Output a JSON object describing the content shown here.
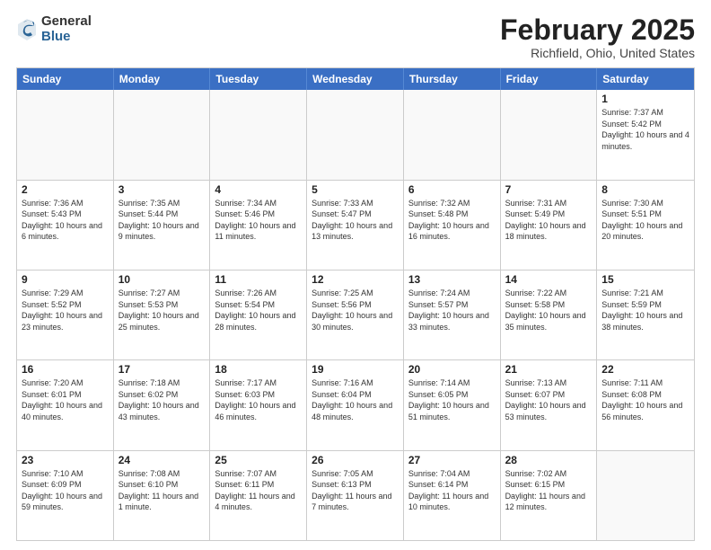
{
  "header": {
    "logo_general": "General",
    "logo_blue": "Blue",
    "title": "February 2025",
    "subtitle": "Richfield, Ohio, United States"
  },
  "days_of_week": [
    "Sunday",
    "Monday",
    "Tuesday",
    "Wednesday",
    "Thursday",
    "Friday",
    "Saturday"
  ],
  "weeks": [
    [
      {
        "day": "",
        "empty": true
      },
      {
        "day": "",
        "empty": true
      },
      {
        "day": "",
        "empty": true
      },
      {
        "day": "",
        "empty": true
      },
      {
        "day": "",
        "empty": true
      },
      {
        "day": "",
        "empty": true
      },
      {
        "day": "1",
        "sunrise": "Sunrise: 7:37 AM",
        "sunset": "Sunset: 5:42 PM",
        "daylight": "Daylight: 10 hours and 4 minutes."
      }
    ],
    [
      {
        "day": "2",
        "sunrise": "Sunrise: 7:36 AM",
        "sunset": "Sunset: 5:43 PM",
        "daylight": "Daylight: 10 hours and 6 minutes."
      },
      {
        "day": "3",
        "sunrise": "Sunrise: 7:35 AM",
        "sunset": "Sunset: 5:44 PM",
        "daylight": "Daylight: 10 hours and 9 minutes."
      },
      {
        "day": "4",
        "sunrise": "Sunrise: 7:34 AM",
        "sunset": "Sunset: 5:46 PM",
        "daylight": "Daylight: 10 hours and 11 minutes."
      },
      {
        "day": "5",
        "sunrise": "Sunrise: 7:33 AM",
        "sunset": "Sunset: 5:47 PM",
        "daylight": "Daylight: 10 hours and 13 minutes."
      },
      {
        "day": "6",
        "sunrise": "Sunrise: 7:32 AM",
        "sunset": "Sunset: 5:48 PM",
        "daylight": "Daylight: 10 hours and 16 minutes."
      },
      {
        "day": "7",
        "sunrise": "Sunrise: 7:31 AM",
        "sunset": "Sunset: 5:49 PM",
        "daylight": "Daylight: 10 hours and 18 minutes."
      },
      {
        "day": "8",
        "sunrise": "Sunrise: 7:30 AM",
        "sunset": "Sunset: 5:51 PM",
        "daylight": "Daylight: 10 hours and 20 minutes."
      }
    ],
    [
      {
        "day": "9",
        "sunrise": "Sunrise: 7:29 AM",
        "sunset": "Sunset: 5:52 PM",
        "daylight": "Daylight: 10 hours and 23 minutes."
      },
      {
        "day": "10",
        "sunrise": "Sunrise: 7:27 AM",
        "sunset": "Sunset: 5:53 PM",
        "daylight": "Daylight: 10 hours and 25 minutes."
      },
      {
        "day": "11",
        "sunrise": "Sunrise: 7:26 AM",
        "sunset": "Sunset: 5:54 PM",
        "daylight": "Daylight: 10 hours and 28 minutes."
      },
      {
        "day": "12",
        "sunrise": "Sunrise: 7:25 AM",
        "sunset": "Sunset: 5:56 PM",
        "daylight": "Daylight: 10 hours and 30 minutes."
      },
      {
        "day": "13",
        "sunrise": "Sunrise: 7:24 AM",
        "sunset": "Sunset: 5:57 PM",
        "daylight": "Daylight: 10 hours and 33 minutes."
      },
      {
        "day": "14",
        "sunrise": "Sunrise: 7:22 AM",
        "sunset": "Sunset: 5:58 PM",
        "daylight": "Daylight: 10 hours and 35 minutes."
      },
      {
        "day": "15",
        "sunrise": "Sunrise: 7:21 AM",
        "sunset": "Sunset: 5:59 PM",
        "daylight": "Daylight: 10 hours and 38 minutes."
      }
    ],
    [
      {
        "day": "16",
        "sunrise": "Sunrise: 7:20 AM",
        "sunset": "Sunset: 6:01 PM",
        "daylight": "Daylight: 10 hours and 40 minutes."
      },
      {
        "day": "17",
        "sunrise": "Sunrise: 7:18 AM",
        "sunset": "Sunset: 6:02 PM",
        "daylight": "Daylight: 10 hours and 43 minutes."
      },
      {
        "day": "18",
        "sunrise": "Sunrise: 7:17 AM",
        "sunset": "Sunset: 6:03 PM",
        "daylight": "Daylight: 10 hours and 46 minutes."
      },
      {
        "day": "19",
        "sunrise": "Sunrise: 7:16 AM",
        "sunset": "Sunset: 6:04 PM",
        "daylight": "Daylight: 10 hours and 48 minutes."
      },
      {
        "day": "20",
        "sunrise": "Sunrise: 7:14 AM",
        "sunset": "Sunset: 6:05 PM",
        "daylight": "Daylight: 10 hours and 51 minutes."
      },
      {
        "day": "21",
        "sunrise": "Sunrise: 7:13 AM",
        "sunset": "Sunset: 6:07 PM",
        "daylight": "Daylight: 10 hours and 53 minutes."
      },
      {
        "day": "22",
        "sunrise": "Sunrise: 7:11 AM",
        "sunset": "Sunset: 6:08 PM",
        "daylight": "Daylight: 10 hours and 56 minutes."
      }
    ],
    [
      {
        "day": "23",
        "sunrise": "Sunrise: 7:10 AM",
        "sunset": "Sunset: 6:09 PM",
        "daylight": "Daylight: 10 hours and 59 minutes."
      },
      {
        "day": "24",
        "sunrise": "Sunrise: 7:08 AM",
        "sunset": "Sunset: 6:10 PM",
        "daylight": "Daylight: 11 hours and 1 minute."
      },
      {
        "day": "25",
        "sunrise": "Sunrise: 7:07 AM",
        "sunset": "Sunset: 6:11 PM",
        "daylight": "Daylight: 11 hours and 4 minutes."
      },
      {
        "day": "26",
        "sunrise": "Sunrise: 7:05 AM",
        "sunset": "Sunset: 6:13 PM",
        "daylight": "Daylight: 11 hours and 7 minutes."
      },
      {
        "day": "27",
        "sunrise": "Sunrise: 7:04 AM",
        "sunset": "Sunset: 6:14 PM",
        "daylight": "Daylight: 11 hours and 10 minutes."
      },
      {
        "day": "28",
        "sunrise": "Sunrise: 7:02 AM",
        "sunset": "Sunset: 6:15 PM",
        "daylight": "Daylight: 11 hours and 12 minutes."
      },
      {
        "day": "",
        "empty": true
      }
    ]
  ]
}
